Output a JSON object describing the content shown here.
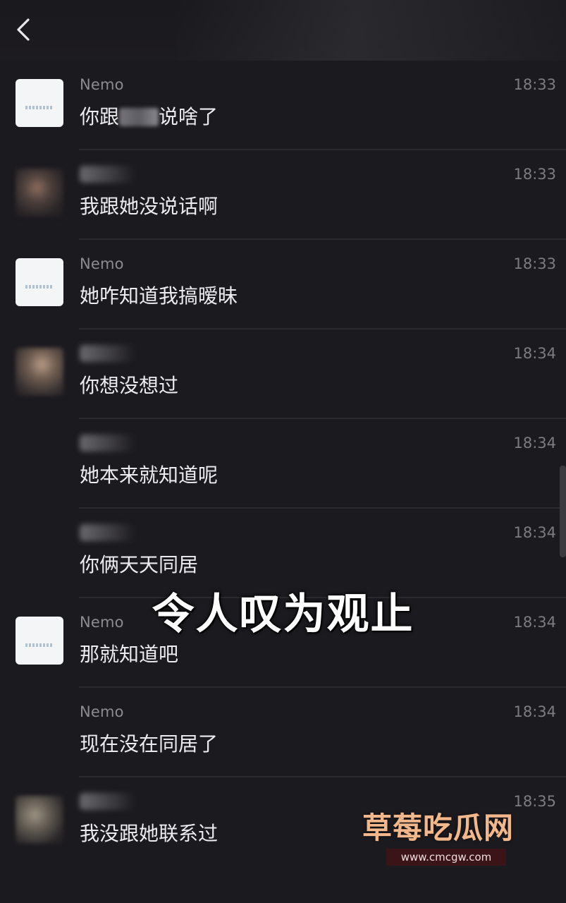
{
  "header": {
    "back_icon": "chevron-left-icon"
  },
  "messages": [
    {
      "sender": "Nemo",
      "time": "18:33",
      "text_before": "你跟",
      "text_after": "说啥了",
      "avatar": "logo"
    },
    {
      "sender": "",
      "time": "18:33",
      "text": "我跟她没说话啊",
      "avatar": "photo"
    },
    {
      "sender": "Nemo",
      "time": "18:33",
      "text": "她咋知道我搞暧昧",
      "avatar": "logo"
    },
    {
      "sender": "",
      "time": "18:34",
      "text": "你想没想过",
      "avatar": "photo"
    },
    {
      "sender": "",
      "time": "18:34",
      "text": "她本来就知道呢",
      "avatar": "none"
    },
    {
      "sender": "",
      "time": "18:34",
      "text": "你俩天天同居",
      "avatar": "none"
    },
    {
      "sender": "Nemo",
      "time": "18:34",
      "text": "那就知道吧",
      "avatar": "logo"
    },
    {
      "sender": "Nemo",
      "time": "18:34",
      "text": "现在没在同居了",
      "avatar": "none"
    },
    {
      "sender": "",
      "time": "18:35",
      "text": "我没跟她联系过",
      "avatar": "photo"
    }
  ],
  "overlay": {
    "caption": "令人叹为观止",
    "watermark_name": "草莓吃瓜网",
    "watermark_url": "www.cmcgw.com"
  }
}
